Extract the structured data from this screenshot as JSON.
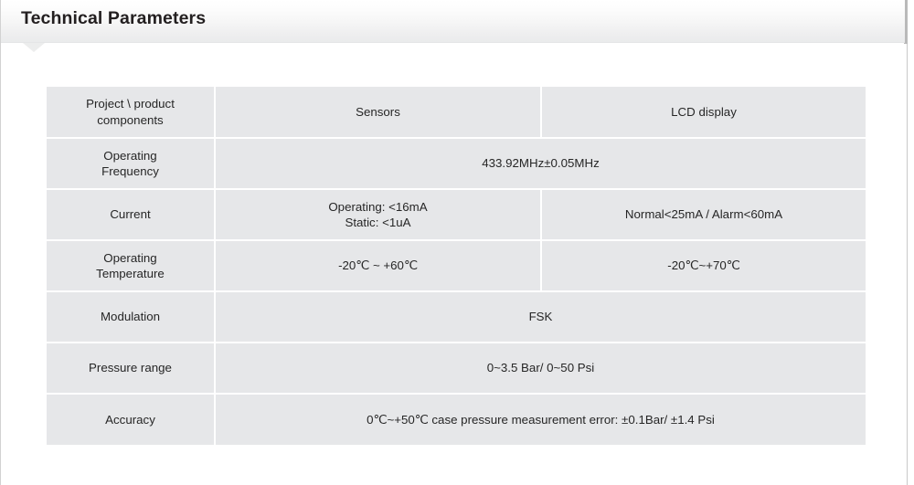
{
  "header": {
    "title": "Technical Parameters",
    "notch_icon": "triangle-down-icon"
  },
  "colors": {
    "page_background": "#ffffff",
    "header_gradient_top": "#ffffff",
    "header_gradient_bottom": "#eaebec",
    "table_cell_background": "#e6e7e9",
    "table_grid_line": "#ffffff",
    "title_text": "#231f20",
    "body_text": "#262626",
    "frame_rule": "#d2d2d2"
  },
  "table": {
    "name": "technical-parameters-table",
    "columns": [
      {
        "key": "component",
        "label": "Project \\ product components"
      },
      {
        "key": "sensors",
        "label": "Sensors"
      },
      {
        "key": "lcd",
        "label": "LCD display"
      }
    ],
    "rows": [
      {
        "label": "Project \\ product components",
        "is_header_row": true,
        "split": true,
        "sensors": "Sensors",
        "lcd": "LCD display"
      },
      {
        "label": "Operating Frequency",
        "label_lines": [
          "Operating",
          "Frequency"
        ],
        "split": false,
        "value": "433.92MHz±0.05MHz"
      },
      {
        "label": "Current",
        "label_lines": [
          "Current"
        ],
        "split": true,
        "sensors_lines": [
          "Operating: <16mA",
          "Static: <1uA"
        ],
        "lcd": "Normal<25mA / Alarm<60mA"
      },
      {
        "label": "Operating Temperature",
        "label_lines": [
          "Operating",
          "Temperature"
        ],
        "split": true,
        "sensors": "-20℃ ~ +60℃",
        "lcd": "-20℃~+70℃"
      },
      {
        "label": "Modulation",
        "label_lines": [
          "Modulation"
        ],
        "split": false,
        "value": "FSK"
      },
      {
        "label": "Pressure range",
        "label_lines": [
          "Pressure range"
        ],
        "split": false,
        "value": "0~3.5 Bar/ 0~50 Psi"
      },
      {
        "label": "Accuracy",
        "label_lines": [
          "Accuracy"
        ],
        "split": false,
        "value": "0℃~+50℃ case pressure measurement error: ±0.1Bar/ ±1.4 Psi"
      }
    ]
  }
}
